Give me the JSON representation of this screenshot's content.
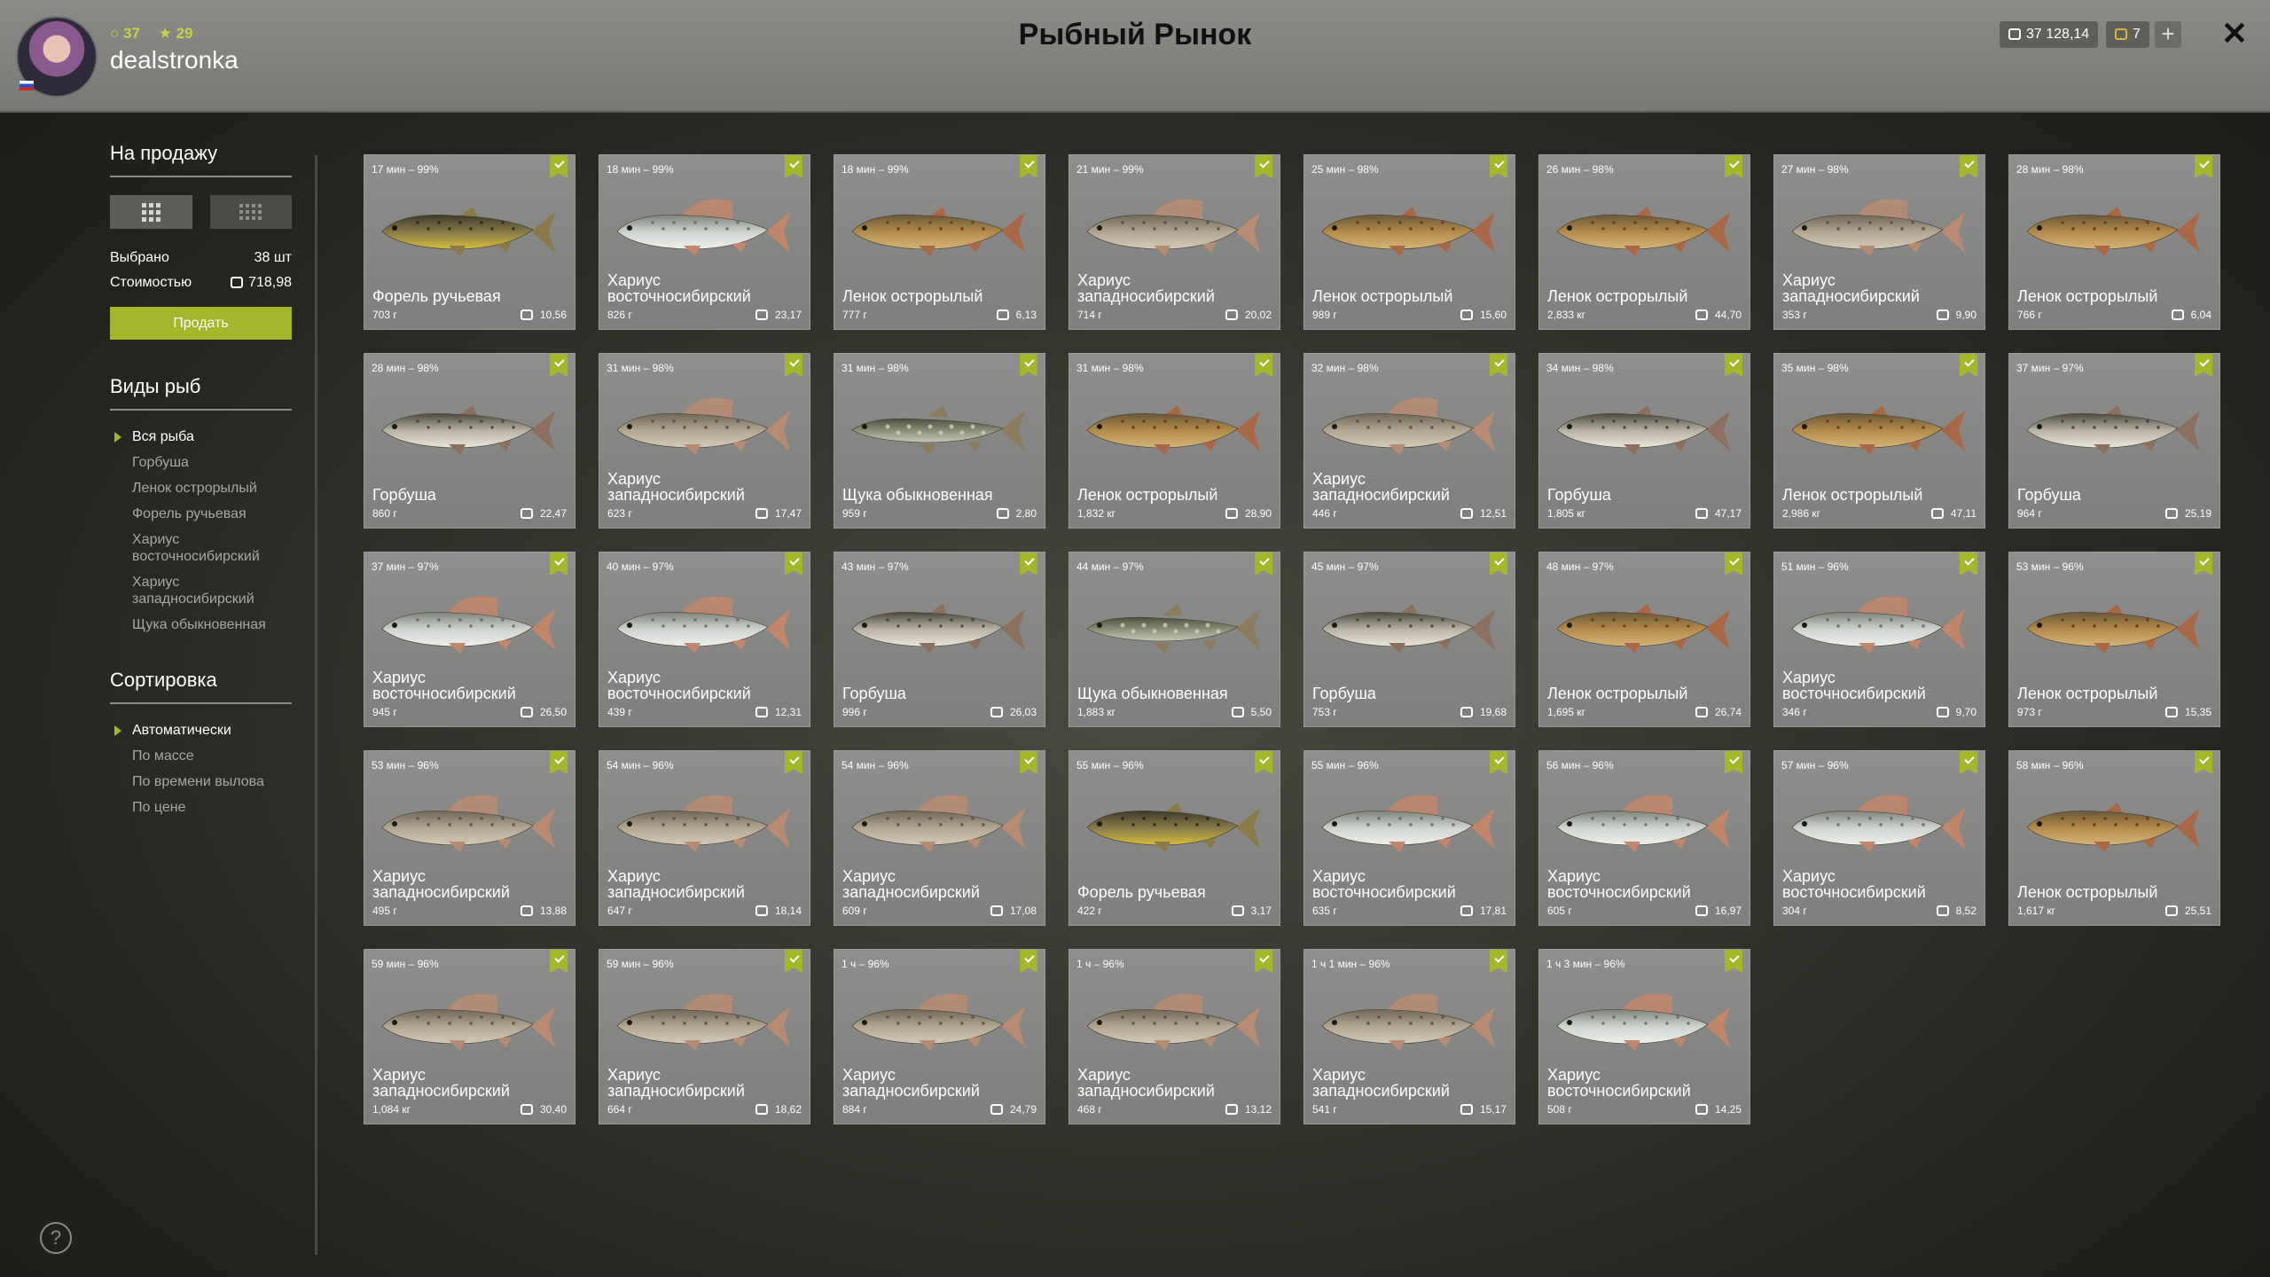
{
  "header": {
    "title": "Рыбный Рынок",
    "username": "dealstronka",
    "level": "37",
    "rank": "29",
    "money": "37 128,14",
    "gold": "7",
    "plus": "+",
    "close": "✕"
  },
  "sidebar": {
    "for_sale_title": "На продажу",
    "selected_label": "Выбрано",
    "selected_value": "38 шт",
    "cost_label": "Стоимостью",
    "cost_value": "718,98",
    "sell_button": "Продать",
    "fish_types_title": "Виды рыб",
    "fish_types": [
      "Вся рыба",
      "Горбуша",
      "Ленок острорылый",
      "Форель ручьевая",
      "Хариус восточносибирский",
      "Хариус западносибирский",
      "Щука обыкновенная"
    ],
    "sort_title": "Сортировка",
    "sort_options": [
      "Автоматически",
      "По массе",
      "По времени вылова",
      "По цене"
    ],
    "help": "?"
  },
  "fish": [
    {
      "time": "17 мин – 99%",
      "name": "Форель ручьевая",
      "weight": "703 г",
      "price": "10,56",
      "kind": "trout"
    },
    {
      "time": "18 мин – 99%",
      "name": "Хариус восточносибирский",
      "weight": "826 г",
      "price": "23,17",
      "kind": "grayling-east"
    },
    {
      "time": "18 мин – 99%",
      "name": "Ленок острорылый",
      "weight": "777 г",
      "price": "6,13",
      "kind": "lenok"
    },
    {
      "time": "21 мин – 99%",
      "name": "Хариус западносибирский",
      "weight": "714 г",
      "price": "20,02",
      "kind": "grayling-west"
    },
    {
      "time": "25 мин – 98%",
      "name": "Ленок острорылый",
      "weight": "989 г",
      "price": "15,60",
      "kind": "lenok"
    },
    {
      "time": "26 мин – 98%",
      "name": "Ленок острорылый",
      "weight": "2,833 кг",
      "price": "44,70",
      "kind": "lenok"
    },
    {
      "time": "27 мин – 98%",
      "name": "Хариус западносибирский",
      "weight": "353 г",
      "price": "9,90",
      "kind": "grayling-west"
    },
    {
      "time": "28 мин – 98%",
      "name": "Ленок острорылый",
      "weight": "766 г",
      "price": "6,04",
      "kind": "lenok"
    },
    {
      "time": "28 мин – 98%",
      "name": "Горбуша",
      "weight": "860 г",
      "price": "22,47",
      "kind": "pink"
    },
    {
      "time": "31 мин – 98%",
      "name": "Хариус западносибирский",
      "weight": "623 г",
      "price": "17,47",
      "kind": "grayling-west"
    },
    {
      "time": "31 мин – 98%",
      "name": "Щука обыкновенная",
      "weight": "959 г",
      "price": "2,80",
      "kind": "pike"
    },
    {
      "time": "31 мин – 98%",
      "name": "Ленок острорылый",
      "weight": "1,832 кг",
      "price": "28,90",
      "kind": "lenok"
    },
    {
      "time": "32 мин – 98%",
      "name": "Хариус западносибирский",
      "weight": "446 г",
      "price": "12,51",
      "kind": "grayling-west"
    },
    {
      "time": "34 мин – 98%",
      "name": "Горбуша",
      "weight": "1,805 кг",
      "price": "47,17",
      "kind": "pink"
    },
    {
      "time": "35 мин – 98%",
      "name": "Ленок острорылый",
      "weight": "2,986 кг",
      "price": "47,11",
      "kind": "lenok"
    },
    {
      "time": "37 мин – 97%",
      "name": "Горбуша",
      "weight": "964 г",
      "price": "25,19",
      "kind": "pink"
    },
    {
      "time": "37 мин – 97%",
      "name": "Хариус восточносибирский",
      "weight": "945 г",
      "price": "26,50",
      "kind": "grayling-east"
    },
    {
      "time": "40 мин – 97%",
      "name": "Хариус восточносибирский",
      "weight": "439 г",
      "price": "12,31",
      "kind": "grayling-east"
    },
    {
      "time": "43 мин – 97%",
      "name": "Горбуша",
      "weight": "996 г",
      "price": "26,03",
      "kind": "pink"
    },
    {
      "time": "44 мин – 97%",
      "name": "Щука обыкновенная",
      "weight": "1,883 кг",
      "price": "5,50",
      "kind": "pike"
    },
    {
      "time": "45 мин – 97%",
      "name": "Горбуша",
      "weight": "753 г",
      "price": "19,68",
      "kind": "pink"
    },
    {
      "time": "48 мин – 97%",
      "name": "Ленок острорылый",
      "weight": "1,695 кг",
      "price": "26,74",
      "kind": "lenok"
    },
    {
      "time": "51 мин – 96%",
      "name": "Хариус восточносибирский",
      "weight": "346 г",
      "price": "9,70",
      "kind": "grayling-east"
    },
    {
      "time": "53 мин – 96%",
      "name": "Ленок острорылый",
      "weight": "973 г",
      "price": "15,35",
      "kind": "lenok"
    },
    {
      "time": "53 мин – 96%",
      "name": "Хариус западносибирский",
      "weight": "495 г",
      "price": "13,88",
      "kind": "grayling-west"
    },
    {
      "time": "54 мин – 96%",
      "name": "Хариус западносибирский",
      "weight": "647 г",
      "price": "18,14",
      "kind": "grayling-west"
    },
    {
      "time": "54 мин – 96%",
      "name": "Хариус западносибирский",
      "weight": "609 г",
      "price": "17,08",
      "kind": "grayling-west"
    },
    {
      "time": "55 мин – 96%",
      "name": "Форель ручьевая",
      "weight": "422 г",
      "price": "3,17",
      "kind": "trout"
    },
    {
      "time": "55 мин – 96%",
      "name": "Хариус восточносибирский",
      "weight": "635 г",
      "price": "17,81",
      "kind": "grayling-east"
    },
    {
      "time": "56 мин – 96%",
      "name": "Хариус восточносибирский",
      "weight": "605 г",
      "price": "16,97",
      "kind": "grayling-east"
    },
    {
      "time": "57 мин – 96%",
      "name": "Хариус восточносибирский",
      "weight": "304 г",
      "price": "8,52",
      "kind": "grayling-east"
    },
    {
      "time": "58 мин – 96%",
      "name": "Ленок острорылый",
      "weight": "1,617 кг",
      "price": "25,51",
      "kind": "lenok"
    },
    {
      "time": "59 мин – 96%",
      "name": "Хариус западносибирский",
      "weight": "1,084 кг",
      "price": "30,40",
      "kind": "grayling-west"
    },
    {
      "time": "59 мин – 96%",
      "name": "Хариус западносибирский",
      "weight": "664 г",
      "price": "18,62",
      "kind": "grayling-west"
    },
    {
      "time": "1 ч – 96%",
      "name": "Хариус западносибирский",
      "weight": "884 г",
      "price": "24,79",
      "kind": "grayling-west"
    },
    {
      "time": "1 ч – 96%",
      "name": "Хариус западносибирский",
      "weight": "468 г",
      "price": "13,12",
      "kind": "grayling-west"
    },
    {
      "time": "1 ч 1 мин – 96%",
      "name": "Хариус западносибирский",
      "weight": "541 г",
      "price": "15,17",
      "kind": "grayling-west"
    },
    {
      "time": "1 ч 3 мин – 96%",
      "name": "Хариус восточносибирский",
      "weight": "508 г",
      "price": "14,25",
      "kind": "grayling-east"
    }
  ]
}
